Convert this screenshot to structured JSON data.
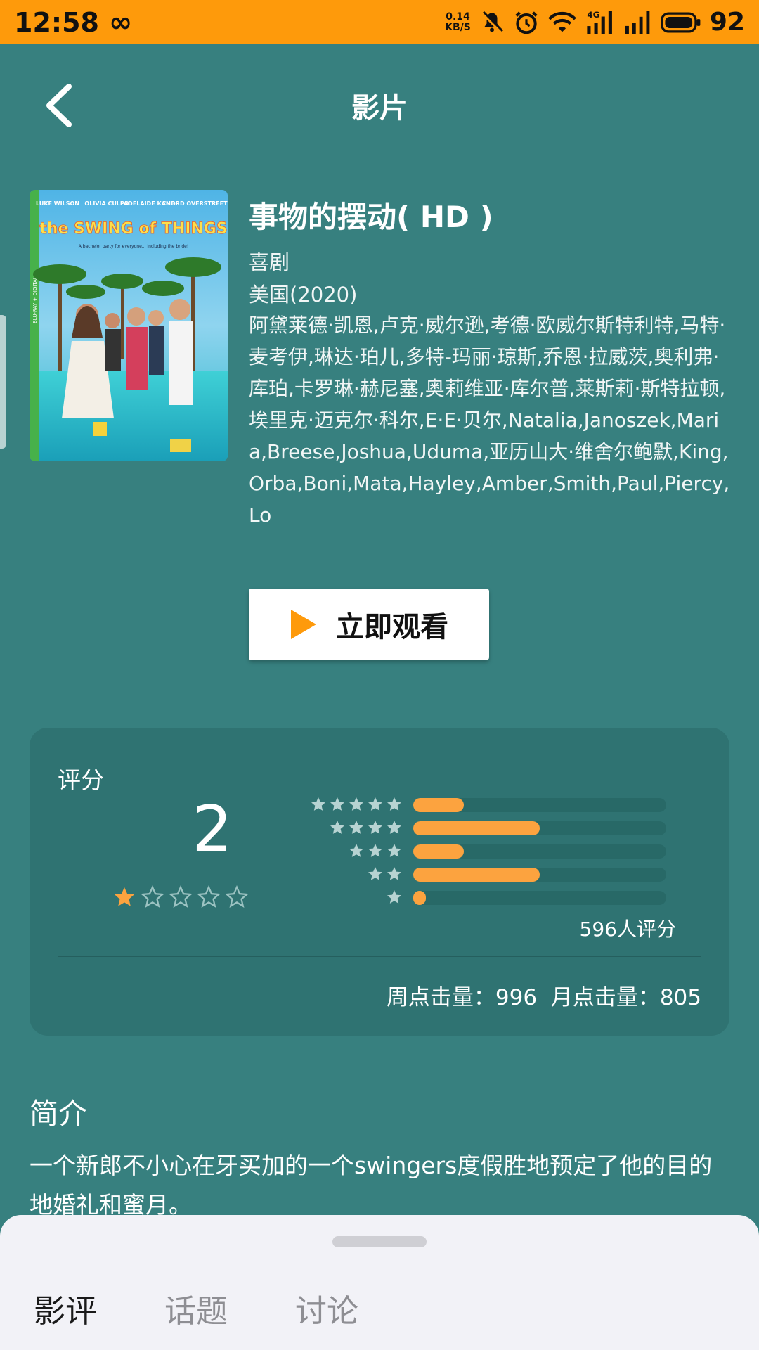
{
  "status_bar": {
    "time": "12:58",
    "infinity_icon": "∞",
    "net_speed_value": "0.14",
    "net_speed_unit": "KB/S",
    "battery": "92",
    "icons": [
      "mute-icon",
      "alarm-icon",
      "wifi-icon",
      "4g-signal-icon",
      "signal-icon",
      "battery-icon"
    ],
    "background_color": "#fe9a0b"
  },
  "header": {
    "title": "影片",
    "back_icon": "chevron-left-icon"
  },
  "movie": {
    "title": "事物的摆动( HD )",
    "genre": "喜剧",
    "country_year": "美国(2020)",
    "cast": "阿黛莱德·凯恩,卢克·威尔逊,考德·欧威尔斯特利特,马特·麦考伊,琳达·珀儿,多特-玛丽·琼斯,乔恩·拉威茨,奥利弗·库珀,卡罗琳·赫尼塞,奥莉维亚·库尔普,莱斯莉·斯特拉顿,埃里克·迈克尔·科尔,E·E·贝尔,Natalia,Janoszek,Maria,Breese,Joshua,Uduma,亚历山大·维舍尔鲍默,King,Orba,Boni,Mata,Hayley,Amber,Smith,Paul,Piercy,Lo",
    "poster": {
      "top_credits": [
        "LUKE WILSON",
        "OLIVIA CULPO",
        "ADELAIDE KANE",
        "CHORD OVERSTREET"
      ],
      "logo": "the SWING of THINGS",
      "tagline": "A bachelor party for everyone... including the bride!",
      "side_text": "BLU-RAY + DIGITAL"
    },
    "watch_button": "立即观看",
    "accent_color": "#fe9a0b"
  },
  "rating": {
    "label": "评分",
    "score": "2",
    "stars_filled": 1,
    "stars_total": 5,
    "distribution": [
      {
        "stars": 5,
        "fraction": 0.2
      },
      {
        "stars": 4,
        "fraction": 0.5
      },
      {
        "stars": 3,
        "fraction": 0.2
      },
      {
        "stars": 2,
        "fraction": 0.5
      },
      {
        "stars": 1,
        "fraction": 0.05
      }
    ],
    "count_text": "596人评分",
    "weekly_clicks": "周点击量：996",
    "monthly_clicks": "月点击量：805",
    "bar_color": "#fca33f"
  },
  "intro": {
    "title": "简介",
    "text": "一个新郎不小心在牙买加的一个swingers度假胜地预定了他的目的地婚礼和蜜月。"
  },
  "tabs": [
    {
      "label": "影评",
      "active": true
    },
    {
      "label": "话题",
      "active": false
    },
    {
      "label": "讨论",
      "active": false
    }
  ]
}
